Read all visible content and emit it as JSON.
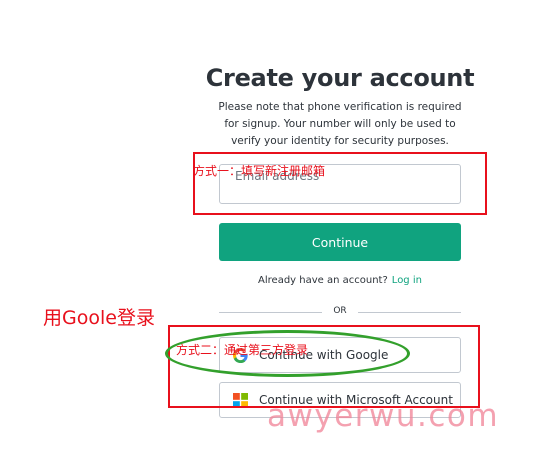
{
  "page": {
    "title": "Create your account",
    "subtitle": "Please note that phone verification is required for signup. Your number will only be used to verify your identity for security purposes."
  },
  "email": {
    "placeholder": "Email address"
  },
  "continue_label": "Continue",
  "login_prompt": {
    "text": "Already have an account?",
    "link": "Log in"
  },
  "divider_text": "OR",
  "social": {
    "google_label": "Continue with Google",
    "microsoft_label": "Continue with Microsoft Account"
  },
  "annotations": {
    "method1": "方式一：填写新注册邮箱",
    "method2": "方式二：通过第三方登录",
    "side_note": "用Goole登录"
  },
  "watermark": "awyerwu.com",
  "colors": {
    "brand": "#10a37f",
    "annotation_red": "#e8101c",
    "annotation_green": "#33a02c"
  }
}
